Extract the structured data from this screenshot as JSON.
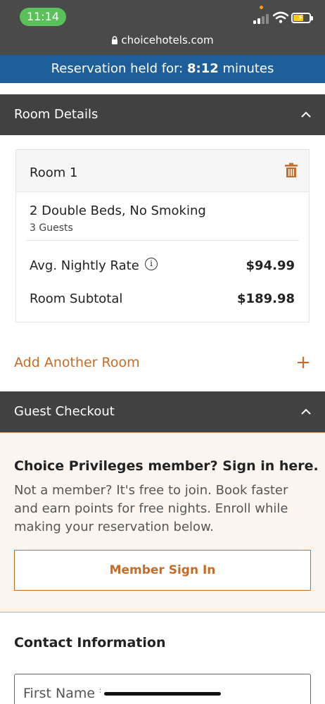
{
  "status_bar": {
    "time": "11:14",
    "url": "choicehotels.com",
    "icons": [
      "signal-icon",
      "wifi-icon",
      "battery-charging-icon",
      "lock-icon"
    ]
  },
  "reservation": {
    "prefix": "Reservation held for:",
    "time": "8:12",
    "suffix": "minutes"
  },
  "room_details": {
    "header": "Room Details",
    "room": {
      "title": "Room 1",
      "bed_type": "2 Double Beds, No Smoking",
      "guests": "3 Guests",
      "rate_label": "Avg. Nightly Rate",
      "rate_value": "$94.99",
      "subtotal_label": "Room Subtotal",
      "subtotal_value": "$189.98"
    },
    "add_room": "Add Another Room",
    "add_symbol": "+"
  },
  "guest_checkout": {
    "header": "Guest Checkout",
    "member_question": "Choice Privileges member? Sign in here.",
    "member_description": "Not a member? It's free to join. Book faster and earn points for free nights. Enroll while making your reservation below.",
    "signin_button": "Member Sign In"
  },
  "contact": {
    "title": "Contact Information",
    "first_name_placeholder": "First Name *"
  },
  "colors": {
    "accent": "#c76b27",
    "header_bg": "#414141",
    "reservation_bg": "#1f5f99",
    "panel_bg": "#fdf6f0"
  }
}
